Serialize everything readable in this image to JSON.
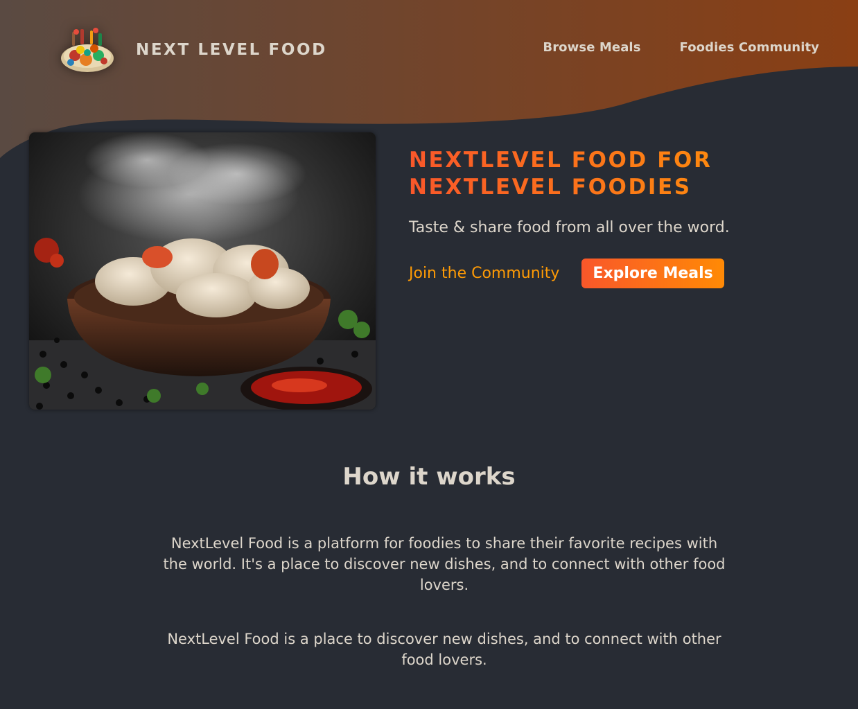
{
  "header": {
    "logo_alt": "A plate with food on it",
    "brand": "NEXT LEVEL FOOD",
    "nav": [
      {
        "label": "Browse Meals"
      },
      {
        "label": "Foodies Community"
      }
    ]
  },
  "hero": {
    "image_alt": "Steaming dumplings in a bowl",
    "title_line1": "NEXTLEVEL FOOD FOR",
    "title_line2": "NEXTLEVEL FOODIES",
    "subtitle": "Taste & share food from all over the word.",
    "join_link": "Join the Community",
    "explore_button": "Explore Meals"
  },
  "how_it_works": {
    "title": "How it works",
    "paragraphs": [
      "NextLevel Food is a platform for foodies to share their favorite recipes with the world. It's a place to discover new dishes, and to connect with other food lovers.",
      "NextLevel Food is a place to discover new dishes, and to connect with other food lovers."
    ]
  },
  "colors": {
    "background": "#282c34",
    "header_gradient_start": "#5a4a42",
    "header_gradient_end": "#8a3f14",
    "accent_orange": "#f9572a",
    "accent_yellow": "#ff9b05",
    "text": "#ddd6cb"
  }
}
